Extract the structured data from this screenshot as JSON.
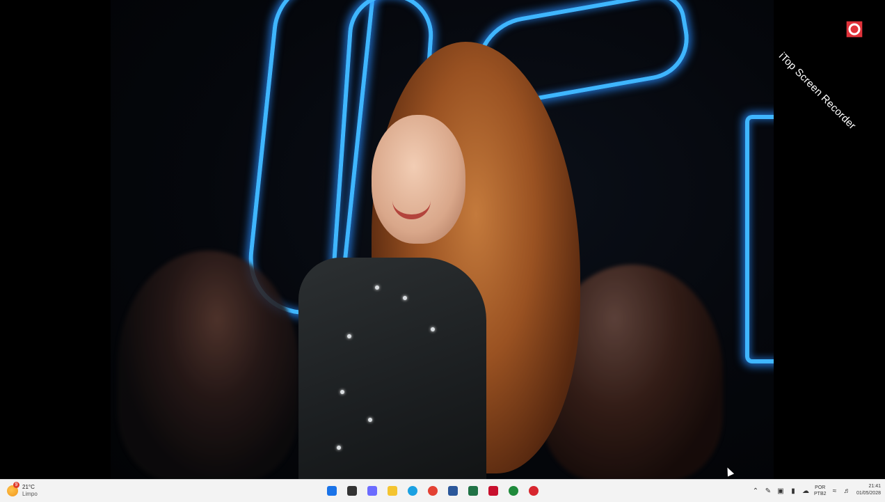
{
  "watermark": {
    "text": "iTop Screen Recorder"
  },
  "taskbar": {
    "weather": {
      "badge": "9",
      "temperature": "21°C",
      "condition": "Limpo"
    },
    "apps": [
      {
        "icon": "windows-start-icon",
        "color": "#1a73e8"
      },
      {
        "icon": "search-icon",
        "color": "#333333"
      },
      {
        "icon": "task-view-icon",
        "color": "#6c6cff"
      },
      {
        "icon": "file-explorer-icon",
        "color": "#f4c430"
      },
      {
        "icon": "edge-icon",
        "color": "#1ba1e2"
      },
      {
        "icon": "chrome-icon",
        "color": "#e34133"
      },
      {
        "icon": "word-icon",
        "color": "#2b579a"
      },
      {
        "icon": "excel-icon",
        "color": "#217346"
      },
      {
        "icon": "red-app-icon",
        "color": "#c8102e"
      },
      {
        "icon": "green-app-icon",
        "color": "#1f8a3b"
      },
      {
        "icon": "screen-recorder-icon",
        "color": "#d7262e"
      }
    ],
    "tray": {
      "lang_line1": "POR",
      "lang_line2": "PTB2"
    },
    "clock": {
      "time": "21:41",
      "date": "01/05/2028"
    }
  }
}
